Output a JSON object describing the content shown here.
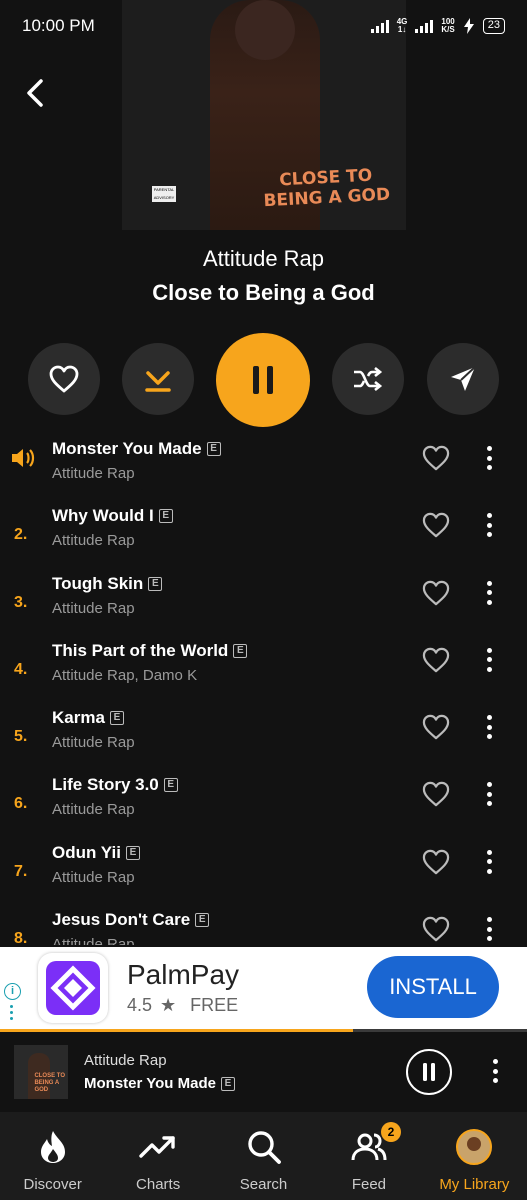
{
  "status_bar": {
    "time": "10:00 PM",
    "network": "4G",
    "speed_value": "100",
    "speed_unit": "K/S",
    "battery": "23"
  },
  "album": {
    "artist": "Attitude Rap",
    "title": "Close to Being a God",
    "cover_text_line1": "CLOSE TO",
    "cover_text_line2": "BEING A GOD"
  },
  "actions": [
    "favorite-icon",
    "download-icon",
    "pause-icon",
    "shuffle-icon",
    "share-icon"
  ],
  "tracks": [
    {
      "number": "",
      "title": "Monster You Made",
      "artist": "Attitude Rap",
      "explicit": "E",
      "playing": true
    },
    {
      "number": "2.",
      "title": "Why Would I",
      "artist": "Attitude Rap",
      "explicit": "E"
    },
    {
      "number": "3.",
      "title": "Tough Skin",
      "artist": "Attitude Rap",
      "explicit": "E"
    },
    {
      "number": "4.",
      "title": "This Part of the World",
      "artist": "Attitude Rap, Damo K",
      "explicit": "E"
    },
    {
      "number": "5.",
      "title": "Karma",
      "artist": "Attitude Rap",
      "explicit": "E"
    },
    {
      "number": "6.",
      "title": "Life Story 3.0",
      "artist": "Attitude Rap",
      "explicit": "E"
    },
    {
      "number": "7.",
      "title": "Odun Yii",
      "artist": "Attitude Rap",
      "explicit": "E"
    },
    {
      "number": "8.",
      "title": "Jesus Don't Care",
      "artist": "Attitude Rap",
      "explicit": "E"
    }
  ],
  "ad": {
    "app_name": "PalmPay",
    "rating": "4.5",
    "price": "FREE",
    "cta": "INSTALL"
  },
  "now_playing": {
    "artist": "Attitude Rap",
    "title": "Monster You Made",
    "explicit": "E",
    "progress": 0.67
  },
  "nav": {
    "items": [
      {
        "label": "Discover",
        "icon": "flame-icon"
      },
      {
        "label": "Charts",
        "icon": "trending-icon"
      },
      {
        "label": "Search",
        "icon": "search-icon"
      },
      {
        "label": "Feed",
        "icon": "people-icon",
        "badge": "2"
      },
      {
        "label": "My Library",
        "icon": "avatar",
        "active": true
      }
    ]
  },
  "colors": {
    "accent": "#f7a51c",
    "background": "#121212",
    "ad_cta": "#1a66d2"
  }
}
